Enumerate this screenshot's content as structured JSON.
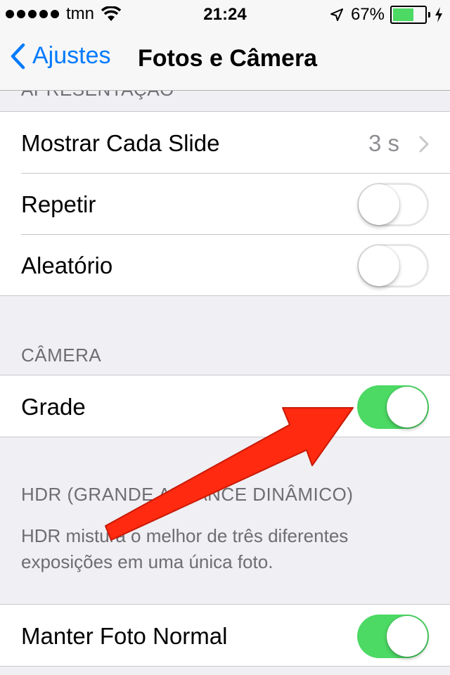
{
  "status_bar": {
    "carrier": "tmn",
    "time": "21:24",
    "battery": "67%",
    "battery_level": 0.67,
    "signal_bars": 5
  },
  "nav": {
    "back_label": "Ajustes",
    "title": "Fotos e Câmera"
  },
  "sections": {
    "presentation_header": "APRESENTAÇÃO",
    "camera_header": "CÂMERA",
    "hdr_header": "HDR (GRANDE ALCANCE DINÂMICO)",
    "hdr_footer": "HDR mistura o melhor de três diferentes exposições em uma única foto."
  },
  "rows": {
    "slide": {
      "label": "Mostrar Cada Slide",
      "value": "3 s"
    },
    "repeat": {
      "label": "Repetir",
      "on": false
    },
    "shuffle": {
      "label": "Aleatório",
      "on": false
    },
    "grid": {
      "label": "Grade",
      "on": true
    },
    "keep_normal": {
      "label": "Manter Foto Normal",
      "on": true
    }
  },
  "colors": {
    "accent": "#007aff",
    "toggle_on": "#4cd964",
    "annotation_arrow": "#ff2a0f"
  }
}
